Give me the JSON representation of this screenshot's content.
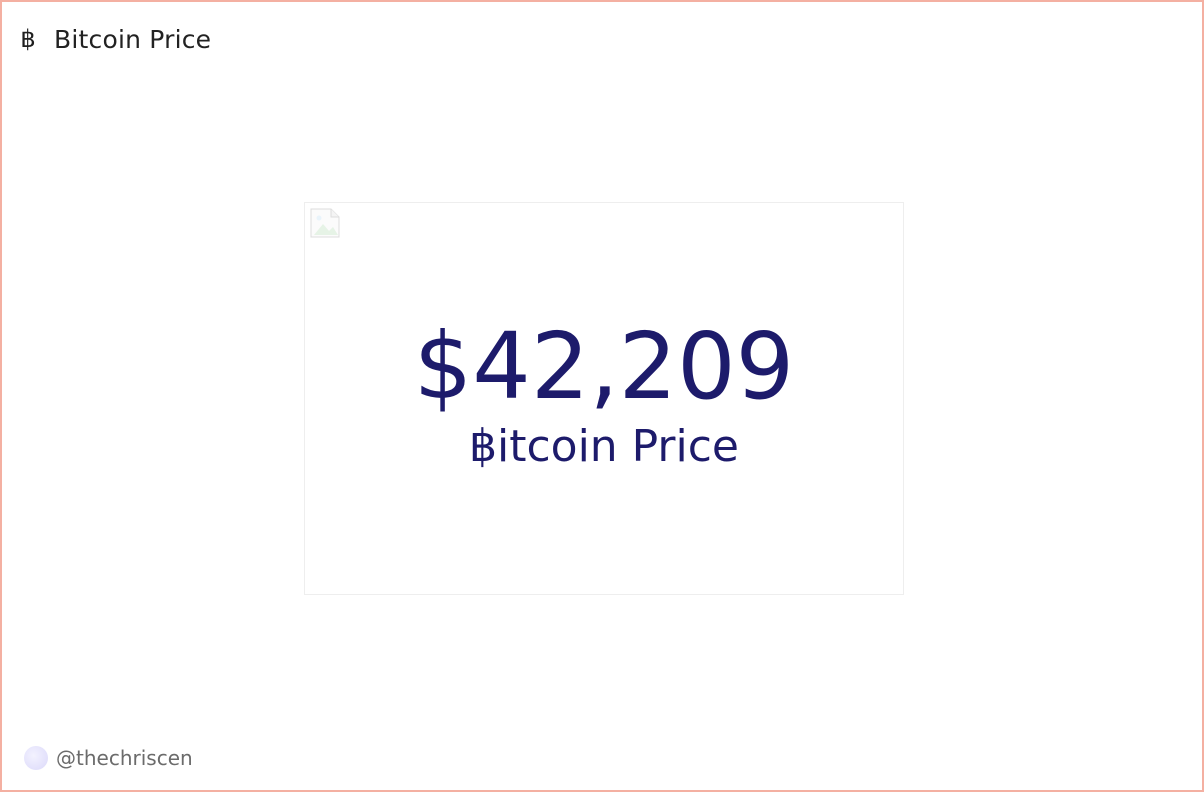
{
  "header": {
    "icon": "bitcoin-icon",
    "icon_glyph": "฿",
    "title": "Bitcoin Price"
  },
  "card": {
    "image": "broken-image-icon",
    "price": "$42,209",
    "label": "฿itcoin Price",
    "value_color": "#1d1b6b"
  },
  "footer": {
    "avatar": "avatar",
    "handle": "@thechriscen"
  },
  "colors": {
    "frame_border": "#f4b0a2",
    "text_dark": "#222222",
    "muted": "#6b6b6b"
  }
}
